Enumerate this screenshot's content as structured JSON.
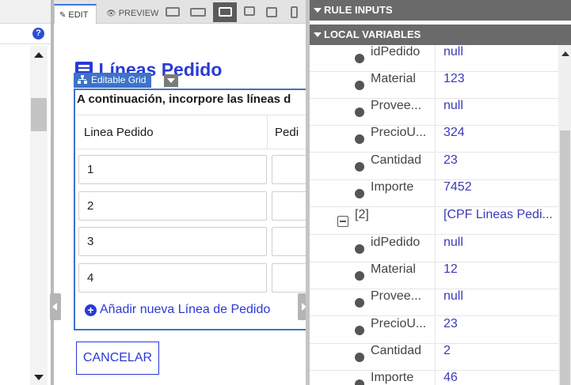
{
  "toolbar": {
    "edit_label": "EDIT",
    "preview_label": "PREVIEW",
    "devices": [
      "edit-code",
      "monitor",
      "desktop",
      "laptop",
      "tablet",
      "phone"
    ]
  },
  "help_icon_text": "?",
  "page": {
    "title": "Líneas Pedido",
    "grid_tag_label": "Editable Grid",
    "instructions": "A continuación, incorpore las líneas d",
    "columns": [
      "Linea Pedido",
      "Pedi"
    ],
    "rows": [
      "1",
      "2",
      "3",
      "4"
    ],
    "add_line_label": "Añadir nueva Línea de Pedido",
    "cancel_label": "CANCELAR"
  },
  "panel": {
    "rule_inputs_label": "RULE INPUTS",
    "local_variables_label": "LOCAL VARIABLES",
    "variables": [
      {
        "name": "idPedido",
        "value": "null"
      },
      {
        "name": "Material",
        "value": "123"
      },
      {
        "name": "Provee...",
        "value": "null"
      },
      {
        "name": "PrecioU...",
        "value": "324"
      },
      {
        "name": "Cantidad",
        "value": "23"
      },
      {
        "name": "Importe",
        "value": "7452"
      },
      {
        "name": "[2]",
        "value": "[CPF Lineas Pedi...",
        "group": true
      },
      {
        "name": "idPedido",
        "value": "null"
      },
      {
        "name": "Material",
        "value": "12"
      },
      {
        "name": "Provee...",
        "value": "null"
      },
      {
        "name": "PrecioU...",
        "value": "23"
      },
      {
        "name": "Cantidad",
        "value": "2"
      },
      {
        "name": "Importe",
        "value": "46"
      }
    ]
  },
  "colors": {
    "accent": "#2a3ad6",
    "grid_border": "#3d73c8",
    "panel_header": "#6a6a6a",
    "value_text": "#3a3ab8"
  }
}
